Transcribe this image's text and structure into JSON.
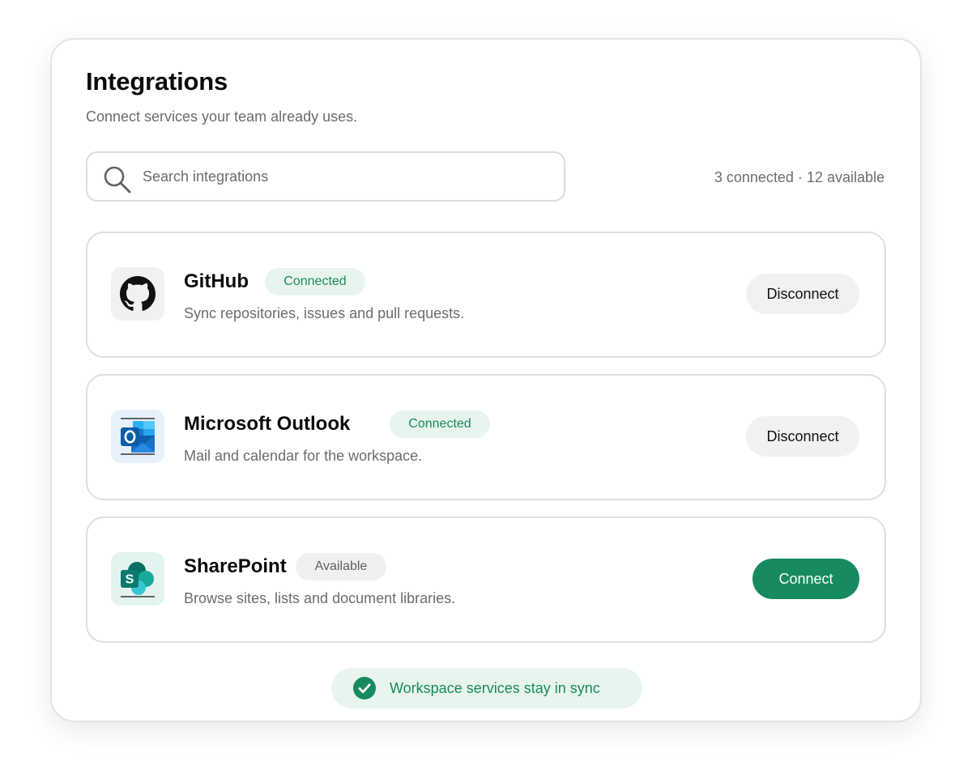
{
  "header": {
    "title": "Integrations",
    "subtitle": "Connect services your team already uses."
  },
  "search": {
    "placeholder": "Search integrations",
    "value": "",
    "icon": "search-icon"
  },
  "summary": {
    "counts": "3 connected · 12 available"
  },
  "integrations": [
    {
      "name": "GitHub",
      "status": "Connected",
      "description": "Sync repositories, issues and pull requests.",
      "action": "Disconnect",
      "icon": "github-icon"
    },
    {
      "name": "Microsoft Outlook",
      "status": "Connected",
      "description": "Mail and calendar for the workspace.",
      "action": "Disconnect",
      "icon": "outlook-icon"
    },
    {
      "name": "SharePoint",
      "status": "Available",
      "description": "Browse sites, lists and document libraries.",
      "action": "Connect",
      "icon": "sharepoint-icon"
    }
  ],
  "footer": {
    "status_text": "Workspace services stay in sync",
    "icon": "check-circle-icon"
  },
  "colors": {
    "accent": "#178a5f",
    "connected_badge_bg": "#e8f5ee",
    "connected_badge_text": "#1a8a5a",
    "available_badge_bg": "#f0f0f1",
    "muted_text": "#6c6c70",
    "border": "#dfdfdf"
  }
}
